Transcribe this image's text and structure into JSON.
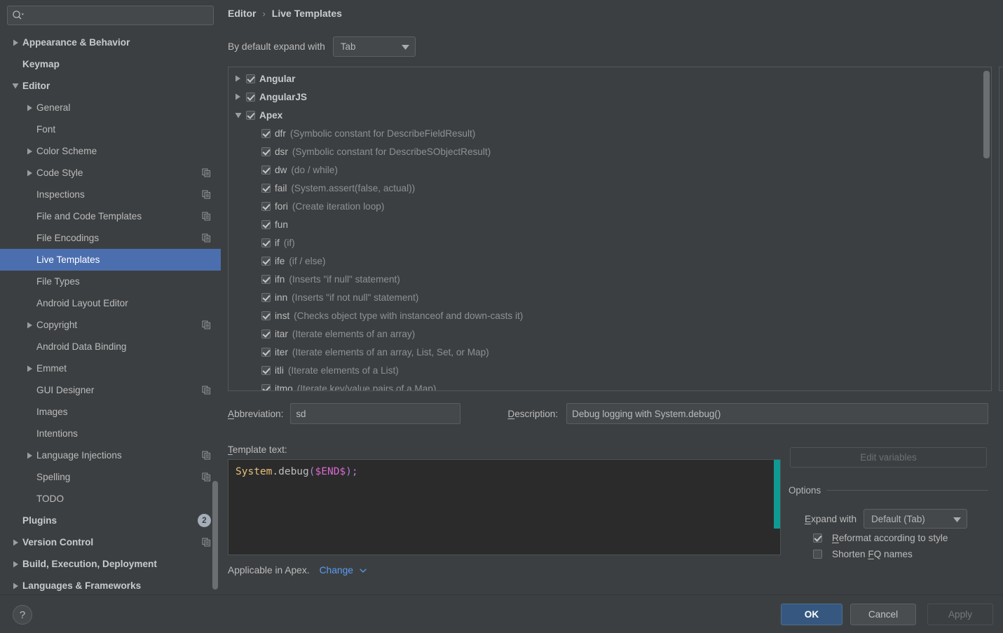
{
  "search": {
    "placeholder": "",
    "value": "",
    "icon": "search-icon"
  },
  "sidebar": {
    "items": [
      {
        "label": "Appearance & Behavior",
        "indent": 0,
        "twisty": "collapsed",
        "bold": true,
        "badge": "",
        "copy": false
      },
      {
        "label": "Keymap",
        "indent": 0,
        "twisty": "none",
        "bold": true,
        "badge": "",
        "copy": false
      },
      {
        "label": "Editor",
        "indent": 0,
        "twisty": "expanded",
        "bold": true,
        "badge": "",
        "copy": false
      },
      {
        "label": "General",
        "indent": 1,
        "twisty": "collapsed",
        "bold": false,
        "badge": "",
        "copy": false
      },
      {
        "label": "Font",
        "indent": 1,
        "twisty": "none",
        "bold": false,
        "badge": "",
        "copy": false
      },
      {
        "label": "Color Scheme",
        "indent": 1,
        "twisty": "collapsed",
        "bold": false,
        "badge": "",
        "copy": false
      },
      {
        "label": "Code Style",
        "indent": 1,
        "twisty": "collapsed",
        "bold": false,
        "badge": "",
        "copy": true
      },
      {
        "label": "Inspections",
        "indent": 1,
        "twisty": "none",
        "bold": false,
        "badge": "",
        "copy": true
      },
      {
        "label": "File and Code Templates",
        "indent": 1,
        "twisty": "none",
        "bold": false,
        "badge": "",
        "copy": true
      },
      {
        "label": "File Encodings",
        "indent": 1,
        "twisty": "none",
        "bold": false,
        "badge": "",
        "copy": true
      },
      {
        "label": "Live Templates",
        "indent": 1,
        "twisty": "none",
        "bold": false,
        "badge": "",
        "copy": false,
        "selected": true
      },
      {
        "label": "File Types",
        "indent": 1,
        "twisty": "none",
        "bold": false,
        "badge": "",
        "copy": false
      },
      {
        "label": "Android Layout Editor",
        "indent": 1,
        "twisty": "none",
        "bold": false,
        "badge": "",
        "copy": false
      },
      {
        "label": "Copyright",
        "indent": 1,
        "twisty": "collapsed",
        "bold": false,
        "badge": "",
        "copy": true
      },
      {
        "label": "Android Data Binding",
        "indent": 1,
        "twisty": "none",
        "bold": false,
        "badge": "",
        "copy": false
      },
      {
        "label": "Emmet",
        "indent": 1,
        "twisty": "collapsed",
        "bold": false,
        "badge": "",
        "copy": false
      },
      {
        "label": "GUI Designer",
        "indent": 1,
        "twisty": "none",
        "bold": false,
        "badge": "",
        "copy": true
      },
      {
        "label": "Images",
        "indent": 1,
        "twisty": "none",
        "bold": false,
        "badge": "",
        "copy": false
      },
      {
        "label": "Intentions",
        "indent": 1,
        "twisty": "none",
        "bold": false,
        "badge": "",
        "copy": false
      },
      {
        "label": "Language Injections",
        "indent": 1,
        "twisty": "collapsed",
        "bold": false,
        "badge": "",
        "copy": true
      },
      {
        "label": "Spelling",
        "indent": 1,
        "twisty": "none",
        "bold": false,
        "badge": "",
        "copy": true
      },
      {
        "label": "TODO",
        "indent": 1,
        "twisty": "none",
        "bold": false,
        "badge": "",
        "copy": false
      },
      {
        "label": "Plugins",
        "indent": 0,
        "twisty": "none",
        "bold": true,
        "badge": "2",
        "copy": false
      },
      {
        "label": "Version Control",
        "indent": 0,
        "twisty": "collapsed",
        "bold": true,
        "badge": "",
        "copy": true
      },
      {
        "label": "Build, Execution, Deployment",
        "indent": 0,
        "twisty": "collapsed",
        "bold": true,
        "badge": "",
        "copy": false
      },
      {
        "label": "Languages & Frameworks",
        "indent": 0,
        "twisty": "collapsed",
        "bold": true,
        "badge": "",
        "copy": false
      }
    ]
  },
  "breadcrumb": {
    "parent": "Editor",
    "separator": "›",
    "current": "Live Templates"
  },
  "expand_default": {
    "label": "By default expand with",
    "value": "Tab"
  },
  "templates_tree": {
    "groups": [
      {
        "name": "Angular",
        "checked": true,
        "expanded": false,
        "children": []
      },
      {
        "name": "AngularJS",
        "checked": true,
        "expanded": false,
        "children": []
      },
      {
        "name": "Apex",
        "checked": true,
        "expanded": true,
        "children": [
          {
            "abbr": "dfr",
            "desc": "(Symbolic constant for DescribeFieldResult)",
            "checked": true
          },
          {
            "abbr": "dsr",
            "desc": "(Symbolic constant for DescribeSObjectResult)",
            "checked": true
          },
          {
            "abbr": "dw",
            "desc": "(do / while)",
            "checked": true
          },
          {
            "abbr": "fail",
            "desc": "(System.assert(false, actual))",
            "checked": true
          },
          {
            "abbr": "fori",
            "desc": "(Create iteration loop)",
            "checked": true
          },
          {
            "abbr": "fun",
            "desc": "",
            "checked": true
          },
          {
            "abbr": "if",
            "desc": "(if)",
            "checked": true
          },
          {
            "abbr": "ife",
            "desc": "(if / else)",
            "checked": true
          },
          {
            "abbr": "ifn",
            "desc": "(Inserts \"if null\" statement)",
            "checked": true
          },
          {
            "abbr": "inn",
            "desc": "(Inserts \"if not null\" statement)",
            "checked": true
          },
          {
            "abbr": "inst",
            "desc": "(Checks object type with instanceof and down-casts it)",
            "checked": true
          },
          {
            "abbr": "itar",
            "desc": "(Iterate elements of an array)",
            "checked": true
          },
          {
            "abbr": "iter",
            "desc": "(Iterate elements of an array, List, Set, or Map)",
            "checked": true
          },
          {
            "abbr": "itli",
            "desc": "(Iterate elements of a List)",
            "checked": true
          },
          {
            "abbr": "itmo",
            "desc": "(Iterate key/value pairs of a Map)",
            "checked": true
          }
        ]
      }
    ]
  },
  "tree_toolbar": [
    {
      "icon": "plus-icon",
      "name": "add-template-button"
    },
    {
      "icon": "minus-icon",
      "name": "remove-template-button"
    },
    {
      "icon": "copy-icon",
      "name": "duplicate-template-button"
    },
    {
      "icon": "revert-icon",
      "name": "restore-defaults-button"
    }
  ],
  "editor": {
    "abbreviation_label": "Abbreviation:",
    "abbreviation_value": "sd",
    "description_label": "Description:",
    "description_value": "Debug logging with System.debug()",
    "template_text_label": "Template text:",
    "code": {
      "type": "System",
      "method": ".debug",
      "open": "(",
      "variable": "$END$",
      "close": ")",
      "semi": ";"
    },
    "edit_variables_label": "Edit variables",
    "options_legend": "Options",
    "expand_with_label": "Expand with",
    "expand_with_value": "Default (Tab)",
    "reformat_label": "Reformat according to style",
    "reformat_checked": true,
    "shorten_label": "Shorten FQ names",
    "shorten_checked": false,
    "applicable_text": "Applicable in Apex.",
    "change_link": "Change"
  },
  "footer": {
    "help": "?",
    "ok": "OK",
    "cancel": "Cancel",
    "apply": "Apply"
  },
  "colors": {
    "accent_selection": "#4b6eaf",
    "ok_button": "#365880",
    "link": "#589df6",
    "code_marker": "#0f9a93",
    "code_bg": "#2b2b2b",
    "panel_bg": "#3c3f41"
  }
}
